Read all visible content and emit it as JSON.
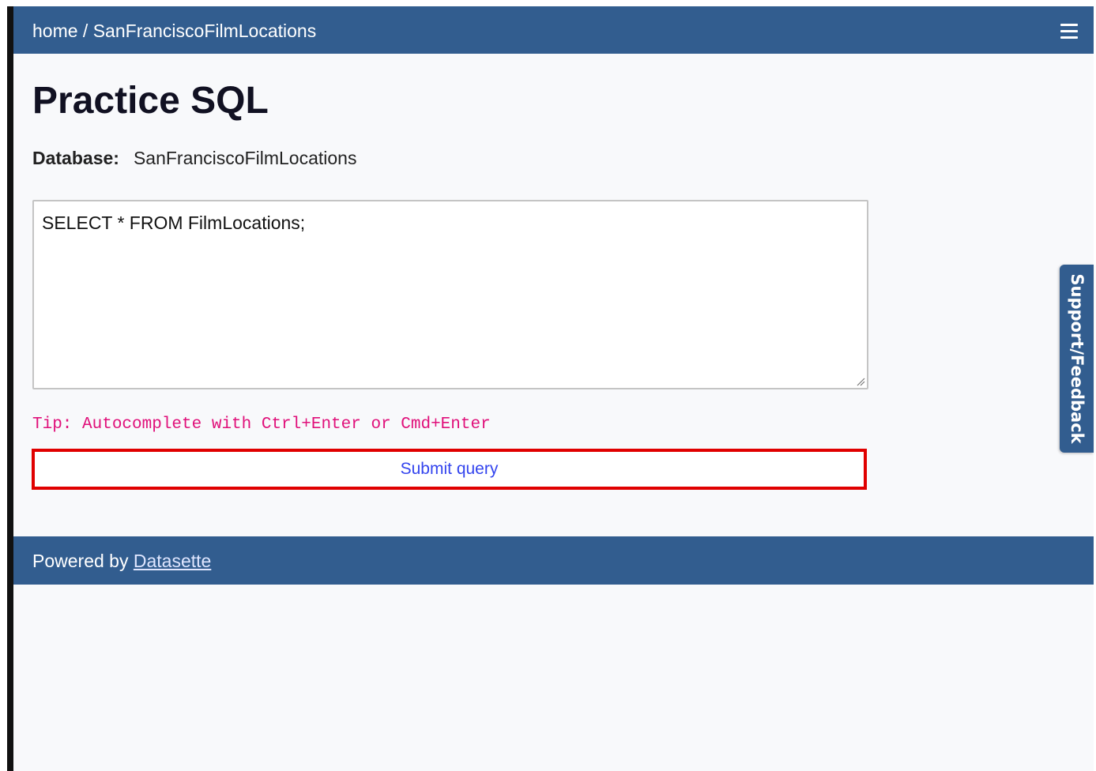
{
  "header": {
    "home_link": "home",
    "separator": " / ",
    "db_link": "SanFranciscoFilmLocations",
    "menu_icon": "hamburger-menu-icon"
  },
  "main": {
    "title": "Practice SQL",
    "database_label": "Database:",
    "database_value": "SanFranciscoFilmLocations",
    "query_text": "SELECT * FROM FilmLocations;",
    "tip": "Tip: Autocomplete with Ctrl+Enter or Cmd+Enter",
    "submit_label": "Submit query"
  },
  "footer": {
    "prefix": "Powered by ",
    "link": "Datasette"
  },
  "feedback_tab": {
    "label": "Support/Feedback"
  },
  "colors": {
    "brand": "#325d8f",
    "tip": "#e0107a",
    "submit_text": "#3344ee",
    "highlight_border": "#e00000"
  }
}
